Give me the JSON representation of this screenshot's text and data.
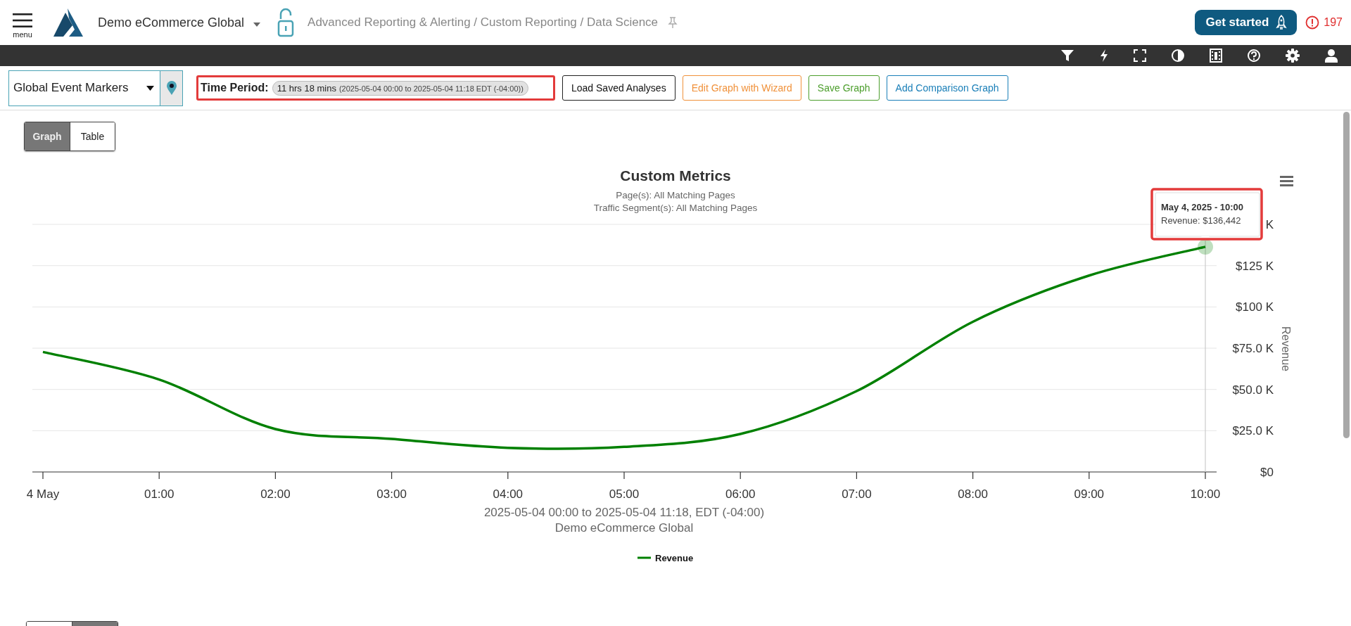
{
  "header": {
    "menu_label": "menu",
    "account": "Demo eCommerce Global",
    "breadcrumb": "Advanced Reporting & Alerting / Custom Reporting / Data Science",
    "get_started": "Get started",
    "alert_count": "197"
  },
  "toolbar": {
    "marker_select": "Global Event Markers",
    "time_period": {
      "label": "Time Period:",
      "duration": "11 hrs 18 mins",
      "range": "(2025-05-04 00:00 to 2025-05-04 11:18 EDT (-04:00))"
    },
    "buttons": [
      {
        "label": "Load Saved Analyses",
        "kind": "plain"
      },
      {
        "label": "Edit Graph with Wizard",
        "kind": "wizard"
      },
      {
        "label": "Save Graph",
        "kind": "save"
      },
      {
        "label": "Add Comparison Graph",
        "kind": "compare"
      }
    ]
  },
  "view_toggle": [
    {
      "label": "Graph",
      "selected": true
    },
    {
      "label": "Table",
      "selected": false
    }
  ],
  "chart": {
    "subtitles": [
      "Page(s): All Matching Pages",
      "Traffic Segment(s): All Matching Pages"
    ],
    "caption": "Demo eCommerce Global",
    "tooltip": {
      "title": "May 4, 2025 - 10:00",
      "text": "Revenue: $136,442"
    },
    "chart_data": {
      "type": "line",
      "title": "Custom Metrics",
      "xlabel": "2025-05-04 00:00 to 2025-05-04 11:18, EDT (-04:00)",
      "ylabel": "Revenue",
      "categories": [
        "4 May",
        "01:00",
        "02:00",
        "03:00",
        "04:00",
        "05:00",
        "06:00",
        "07:00",
        "08:00",
        "09:00",
        "10:00"
      ],
      "series": [
        {
          "name": "Revenue",
          "color": "#008000",
          "values": [
            72700,
            56000,
            26000,
            20000,
            14600,
            15200,
            23000,
            49000,
            91000,
            119000,
            136400
          ]
        }
      ],
      "ylim": [
        0,
        150000
      ],
      "grid": true,
      "yticks": [
        {
          "value": 0,
          "label": "$0"
        },
        {
          "value": 25000,
          "label": "$25.0 K"
        },
        {
          "value": 50000,
          "label": "$50.0 K"
        },
        {
          "value": 75000,
          "label": "$75.0 K"
        },
        {
          "value": 100000,
          "label": "$100 K"
        },
        {
          "value": 125000,
          "label": "$125 K"
        },
        {
          "value": 150000,
          "label": "K"
        }
      ]
    }
  },
  "bottom_toggle": [
    {
      "selected": false
    },
    {
      "selected": true
    }
  ]
}
